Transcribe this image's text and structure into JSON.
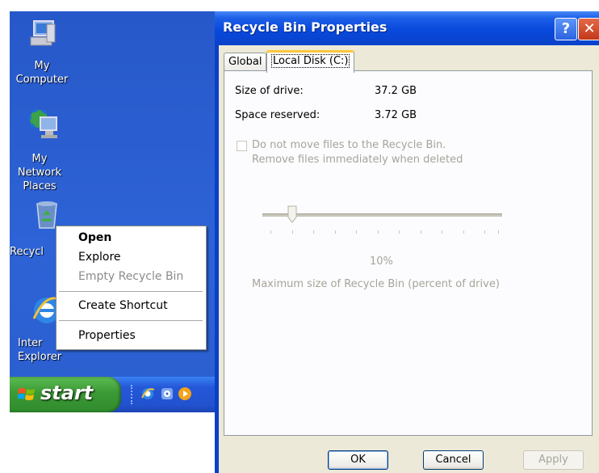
{
  "desktop": {
    "icons": [
      {
        "label": "My Computer",
        "icon": "my-computer-icon"
      },
      {
        "label_line1": "My Network",
        "label_line2": "Places",
        "icon": "network-places-icon"
      },
      {
        "label": "Recycl",
        "icon": "recycle-bin-icon"
      },
      {
        "label_line1": "Inter",
        "label_line2": "Explorer",
        "icon": "internet-explorer-icon"
      }
    ]
  },
  "taskbar": {
    "start_label": "start",
    "quick_launch": [
      "ie-icon",
      "media-icon",
      "player-icon"
    ]
  },
  "context_menu": {
    "items": [
      {
        "label": "Open",
        "bold": true,
        "enabled": true
      },
      {
        "label": "Explore",
        "enabled": true
      },
      {
        "label": "Empty Recycle Bin",
        "enabled": false
      },
      {
        "label": "Create Shortcut",
        "enabled": true
      },
      {
        "label": "Properties",
        "enabled": true
      }
    ]
  },
  "dialog": {
    "title": "Recycle Bin Properties",
    "help_glyph": "?",
    "close_glyph": "✕",
    "tabs": [
      {
        "label": "Global"
      },
      {
        "label": "Local Disk (C:)",
        "active": true
      }
    ],
    "size_label": "Size of drive:",
    "size_value": "37.2 GB",
    "reserved_label": "Space reserved:",
    "reserved_value": "3.72 GB",
    "checkbox_line1": "Do not move files to the Recycle Bin.",
    "checkbox_line2": "Remove files immediately when deleted",
    "slider_value": "10%",
    "slider_caption": "Maximum size of Recycle Bin (percent of drive)",
    "buttons": {
      "ok": "OK",
      "cancel": "Cancel",
      "apply": "Apply"
    }
  },
  "colors": {
    "desktop_blue": "#2b5fd0",
    "title_blue": "#0849dd",
    "start_green": "#3c9a36",
    "dialog_face": "#ece9d8",
    "tab_accent": "#ffc83c"
  }
}
